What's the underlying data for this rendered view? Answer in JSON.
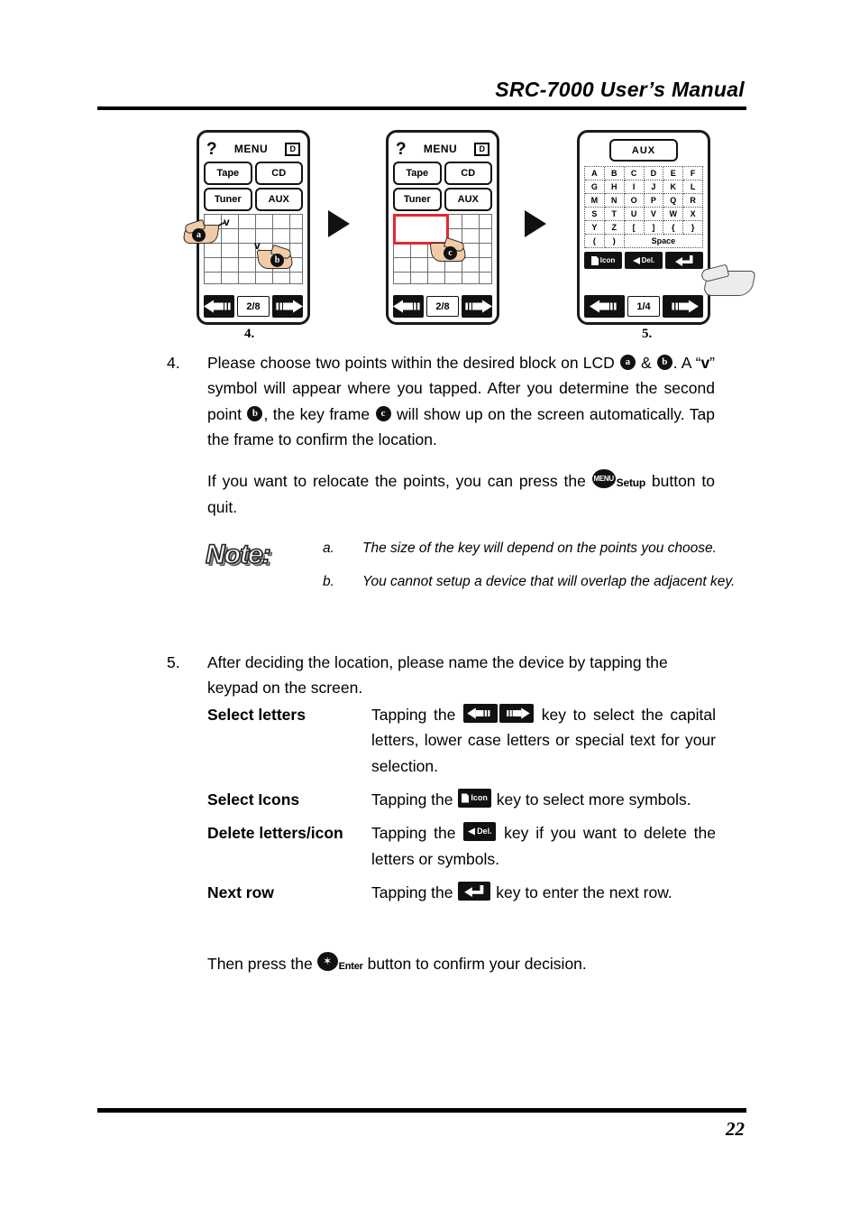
{
  "header": {
    "title": "SRC-7000 User’s Manual"
  },
  "footer": {
    "page_number": "22"
  },
  "figures": {
    "caption_left": "4.",
    "caption_right": "5.",
    "lcd1": {
      "help_icon": "?",
      "menu_label": "MENU",
      "device_badge": "D",
      "buttons": [
        "Tape",
        "CD",
        "Tuner",
        "AUX"
      ],
      "page_indicator": "2/8",
      "marker_a": "a",
      "marker_b": "b",
      "tap_symbol": "v"
    },
    "lcd2": {
      "help_icon": "?",
      "menu_label": "MENU",
      "device_badge": "D",
      "buttons": [
        "Tape",
        "CD",
        "Tuner",
        "AUX"
      ],
      "page_indicator": "2/8",
      "marker_c": "c",
      "frame_color": "#e8262c"
    },
    "lcd3": {
      "name_field_value": "AUX",
      "keyboard_rows": [
        [
          "A",
          "B",
          "C",
          "D",
          "E",
          "F"
        ],
        [
          "G",
          "H",
          "I",
          "J",
          "K",
          "L"
        ],
        [
          "M",
          "N",
          "O",
          "P",
          "Q",
          "R"
        ],
        [
          "S",
          "T",
          "U",
          "V",
          "W",
          "X"
        ],
        [
          "Y",
          "Z",
          "[",
          "]",
          "{",
          "}"
        ]
      ],
      "last_row": {
        "left": "(",
        "right": ")",
        "space": "Space"
      },
      "fn_icon_label": "Icon",
      "fn_del_label": "Del.",
      "page_indicator": "1/4"
    }
  },
  "steps": {
    "step4": {
      "number": "4.",
      "part1": "Please choose two points within the desired block on LCD ",
      "marker_a": "a",
      "amp": " & ",
      "marker_b": "b",
      "part2": ". A “",
      "v_symbol": "v",
      "part3": "” symbol will appear where you tapped. After you determine the second point ",
      "marker_b2": "b",
      "part4": ", the key frame ",
      "marker_c": "c",
      "part5": " will show up on the screen automatically. Tap the frame to confirm the location."
    },
    "relocate": {
      "part1": "If you want to relocate the points, you can press the ",
      "menu_icon_text": "MENU",
      "setup_word": "Setup",
      "part2": " button to quit."
    },
    "step5": {
      "number": "5.",
      "text": "After deciding the location, please name the device by tapping the keypad on the screen."
    }
  },
  "note": {
    "title": "Note:",
    "items": [
      {
        "mark": "a.",
        "text": "The size of the key will depend on the points you choose."
      },
      {
        "mark": "b.",
        "text": "You cannot setup a device that will overlap the adjacent key."
      }
    ]
  },
  "definitions": [
    {
      "term": "Select letters",
      "before": "Tapping the ",
      "key_left_label": "",
      "key_right_label": "",
      "after": " key to select the capital letters, lower case letters or special text for your selection."
    },
    {
      "term": "Select Icons",
      "before": "Tapping the ",
      "key_label": "Icon",
      "after": " key to select more symbols."
    },
    {
      "term": "Delete letters/icon",
      "before": "Tapping the ",
      "key_label": "Del.",
      "after": " key if you want to delete the letters or symbols."
    },
    {
      "term": "Next row",
      "before": "Tapping the ",
      "key_label": "",
      "after": " key to enter the next row."
    }
  ],
  "final": {
    "part1": "Then press the ",
    "enter_word": "Enter",
    "part2": " button to confirm your decision."
  }
}
